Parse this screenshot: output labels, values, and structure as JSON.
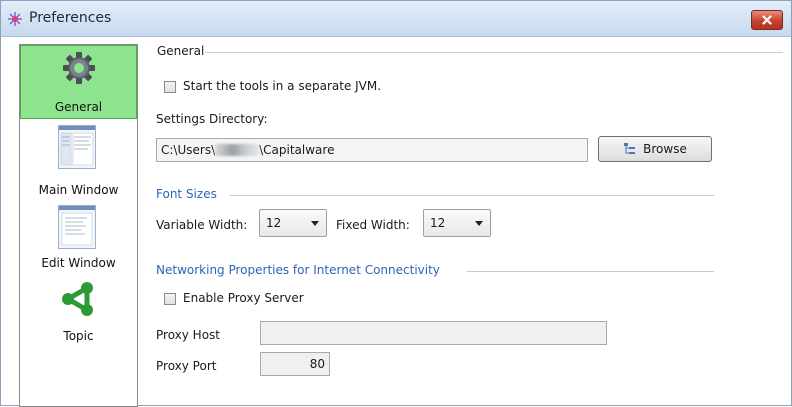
{
  "window": {
    "title": "Preferences"
  },
  "sidebar": {
    "items": [
      {
        "label": "General",
        "icon": "gear-icon",
        "selected": true
      },
      {
        "label": "Main Window",
        "icon": "main-window-thumbnail-icon",
        "selected": false
      },
      {
        "label": "Edit Window",
        "icon": "edit-window-thumbnail-icon",
        "selected": false
      },
      {
        "label": "Topic",
        "icon": "topic-network-icon",
        "selected": false
      }
    ]
  },
  "general": {
    "section_title": "General",
    "separate_jvm_label": "Start the tools in a separate JVM.",
    "separate_jvm_checked": false,
    "settings_dir_label": "Settings Directory:",
    "settings_dir_prefix": "C:\\Users\\",
    "settings_dir_suffix": "\\Capitalware",
    "browse_label": "Browse"
  },
  "font_sizes": {
    "section_title": "Font Sizes",
    "variable_width_label": "Variable Width:",
    "variable_width_value": "12",
    "fixed_width_label": "Fixed Width:",
    "fixed_width_value": "12"
  },
  "networking": {
    "section_title": "Networking Properties for Internet Connectivity",
    "enable_proxy_label": "Enable Proxy Server",
    "enable_proxy_checked": false,
    "proxy_host_label": "Proxy Host",
    "proxy_host_value": "",
    "proxy_port_label": "Proxy Port",
    "proxy_port_value": "80"
  },
  "colors": {
    "selected_nav_bg": "#8ee38e",
    "section_title_blue": "#2e63b8",
    "close_button_red": "#c8412c"
  }
}
